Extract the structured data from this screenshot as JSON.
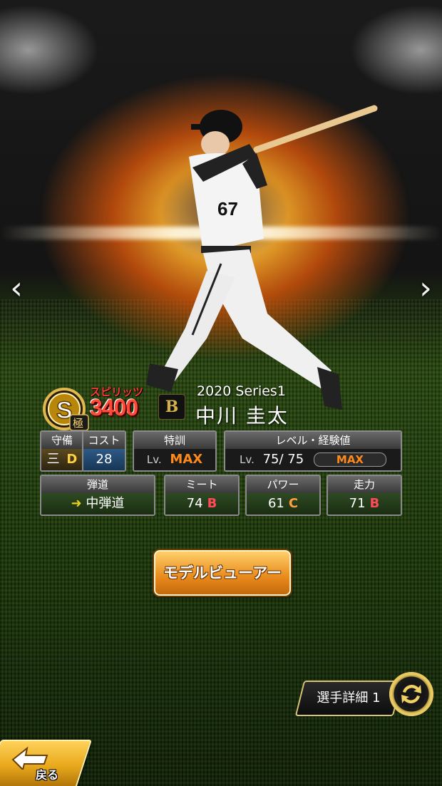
{
  "card": {
    "rank_icon": "s-kiwami-rank-icon",
    "spirits_label": "スピリッツ",
    "spirits_value": "3400",
    "team_logo_letter": "B",
    "series": "2020 Series1",
    "player_name": "中川 圭太"
  },
  "stats": {
    "defense_label": "守備",
    "defense_pos": "三",
    "defense_grade": "D",
    "cost_label": "コスト",
    "cost_value": "28",
    "training_label": "特訓",
    "training_lv": "Lv.",
    "training_value": "MAX",
    "level_label": "レベル・経験値",
    "level_lv": "Lv.",
    "level_value": "75/ 75",
    "exp_bar_label": "MAX",
    "exp_progress": 1.0,
    "trajectory_label": "弾道",
    "trajectory_value": "中弾道",
    "meet_label": "ミート",
    "meet_value": "74",
    "meet_grade": "B",
    "power_label": "パワー",
    "power_value": "61",
    "power_grade": "C",
    "speed_label": "走力",
    "speed_value": "71",
    "speed_grade": "B"
  },
  "buttons": {
    "model_viewer": "モデルビューアー",
    "player_detail": "選手詳細 1",
    "back": "戻る"
  },
  "nav": {
    "prev": "‹",
    "next": "›"
  },
  "colors": {
    "accent_orange": "#e88a1c",
    "grade_b": "#ff4a5a",
    "grade_c": "#ffa040",
    "spirits": "#ff4a3a"
  }
}
